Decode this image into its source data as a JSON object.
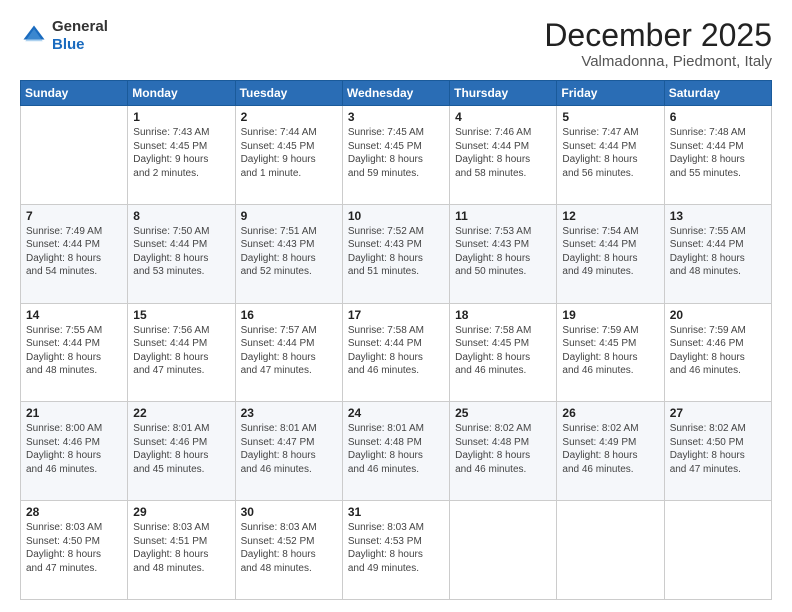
{
  "logo": {
    "general": "General",
    "blue": "Blue"
  },
  "header": {
    "month": "December 2025",
    "location": "Valmadonna, Piedmont, Italy"
  },
  "days_of_week": [
    "Sunday",
    "Monday",
    "Tuesday",
    "Wednesday",
    "Thursday",
    "Friday",
    "Saturday"
  ],
  "weeks": [
    [
      {
        "day": "",
        "content": ""
      },
      {
        "day": "1",
        "content": "Sunrise: 7:43 AM\nSunset: 4:45 PM\nDaylight: 9 hours\nand 2 minutes."
      },
      {
        "day": "2",
        "content": "Sunrise: 7:44 AM\nSunset: 4:45 PM\nDaylight: 9 hours\nand 1 minute."
      },
      {
        "day": "3",
        "content": "Sunrise: 7:45 AM\nSunset: 4:45 PM\nDaylight: 8 hours\nand 59 minutes."
      },
      {
        "day": "4",
        "content": "Sunrise: 7:46 AM\nSunset: 4:44 PM\nDaylight: 8 hours\nand 58 minutes."
      },
      {
        "day": "5",
        "content": "Sunrise: 7:47 AM\nSunset: 4:44 PM\nDaylight: 8 hours\nand 56 minutes."
      },
      {
        "day": "6",
        "content": "Sunrise: 7:48 AM\nSunset: 4:44 PM\nDaylight: 8 hours\nand 55 minutes."
      }
    ],
    [
      {
        "day": "7",
        "content": "Sunrise: 7:49 AM\nSunset: 4:44 PM\nDaylight: 8 hours\nand 54 minutes."
      },
      {
        "day": "8",
        "content": "Sunrise: 7:50 AM\nSunset: 4:44 PM\nDaylight: 8 hours\nand 53 minutes."
      },
      {
        "day": "9",
        "content": "Sunrise: 7:51 AM\nSunset: 4:43 PM\nDaylight: 8 hours\nand 52 minutes."
      },
      {
        "day": "10",
        "content": "Sunrise: 7:52 AM\nSunset: 4:43 PM\nDaylight: 8 hours\nand 51 minutes."
      },
      {
        "day": "11",
        "content": "Sunrise: 7:53 AM\nSunset: 4:43 PM\nDaylight: 8 hours\nand 50 minutes."
      },
      {
        "day": "12",
        "content": "Sunrise: 7:54 AM\nSunset: 4:44 PM\nDaylight: 8 hours\nand 49 minutes."
      },
      {
        "day": "13",
        "content": "Sunrise: 7:55 AM\nSunset: 4:44 PM\nDaylight: 8 hours\nand 48 minutes."
      }
    ],
    [
      {
        "day": "14",
        "content": "Sunrise: 7:55 AM\nSunset: 4:44 PM\nDaylight: 8 hours\nand 48 minutes."
      },
      {
        "day": "15",
        "content": "Sunrise: 7:56 AM\nSunset: 4:44 PM\nDaylight: 8 hours\nand 47 minutes."
      },
      {
        "day": "16",
        "content": "Sunrise: 7:57 AM\nSunset: 4:44 PM\nDaylight: 8 hours\nand 47 minutes."
      },
      {
        "day": "17",
        "content": "Sunrise: 7:58 AM\nSunset: 4:44 PM\nDaylight: 8 hours\nand 46 minutes."
      },
      {
        "day": "18",
        "content": "Sunrise: 7:58 AM\nSunset: 4:45 PM\nDaylight: 8 hours\nand 46 minutes."
      },
      {
        "day": "19",
        "content": "Sunrise: 7:59 AM\nSunset: 4:45 PM\nDaylight: 8 hours\nand 46 minutes."
      },
      {
        "day": "20",
        "content": "Sunrise: 7:59 AM\nSunset: 4:46 PM\nDaylight: 8 hours\nand 46 minutes."
      }
    ],
    [
      {
        "day": "21",
        "content": "Sunrise: 8:00 AM\nSunset: 4:46 PM\nDaylight: 8 hours\nand 46 minutes."
      },
      {
        "day": "22",
        "content": "Sunrise: 8:01 AM\nSunset: 4:46 PM\nDaylight: 8 hours\nand 45 minutes."
      },
      {
        "day": "23",
        "content": "Sunrise: 8:01 AM\nSunset: 4:47 PM\nDaylight: 8 hours\nand 46 minutes."
      },
      {
        "day": "24",
        "content": "Sunrise: 8:01 AM\nSunset: 4:48 PM\nDaylight: 8 hours\nand 46 minutes."
      },
      {
        "day": "25",
        "content": "Sunrise: 8:02 AM\nSunset: 4:48 PM\nDaylight: 8 hours\nand 46 minutes."
      },
      {
        "day": "26",
        "content": "Sunrise: 8:02 AM\nSunset: 4:49 PM\nDaylight: 8 hours\nand 46 minutes."
      },
      {
        "day": "27",
        "content": "Sunrise: 8:02 AM\nSunset: 4:50 PM\nDaylight: 8 hours\nand 47 minutes."
      }
    ],
    [
      {
        "day": "28",
        "content": "Sunrise: 8:03 AM\nSunset: 4:50 PM\nDaylight: 8 hours\nand 47 minutes."
      },
      {
        "day": "29",
        "content": "Sunrise: 8:03 AM\nSunset: 4:51 PM\nDaylight: 8 hours\nand 48 minutes."
      },
      {
        "day": "30",
        "content": "Sunrise: 8:03 AM\nSunset: 4:52 PM\nDaylight: 8 hours\nand 48 minutes."
      },
      {
        "day": "31",
        "content": "Sunrise: 8:03 AM\nSunset: 4:53 PM\nDaylight: 8 hours\nand 49 minutes."
      },
      {
        "day": "",
        "content": ""
      },
      {
        "day": "",
        "content": ""
      },
      {
        "day": "",
        "content": ""
      }
    ]
  ]
}
